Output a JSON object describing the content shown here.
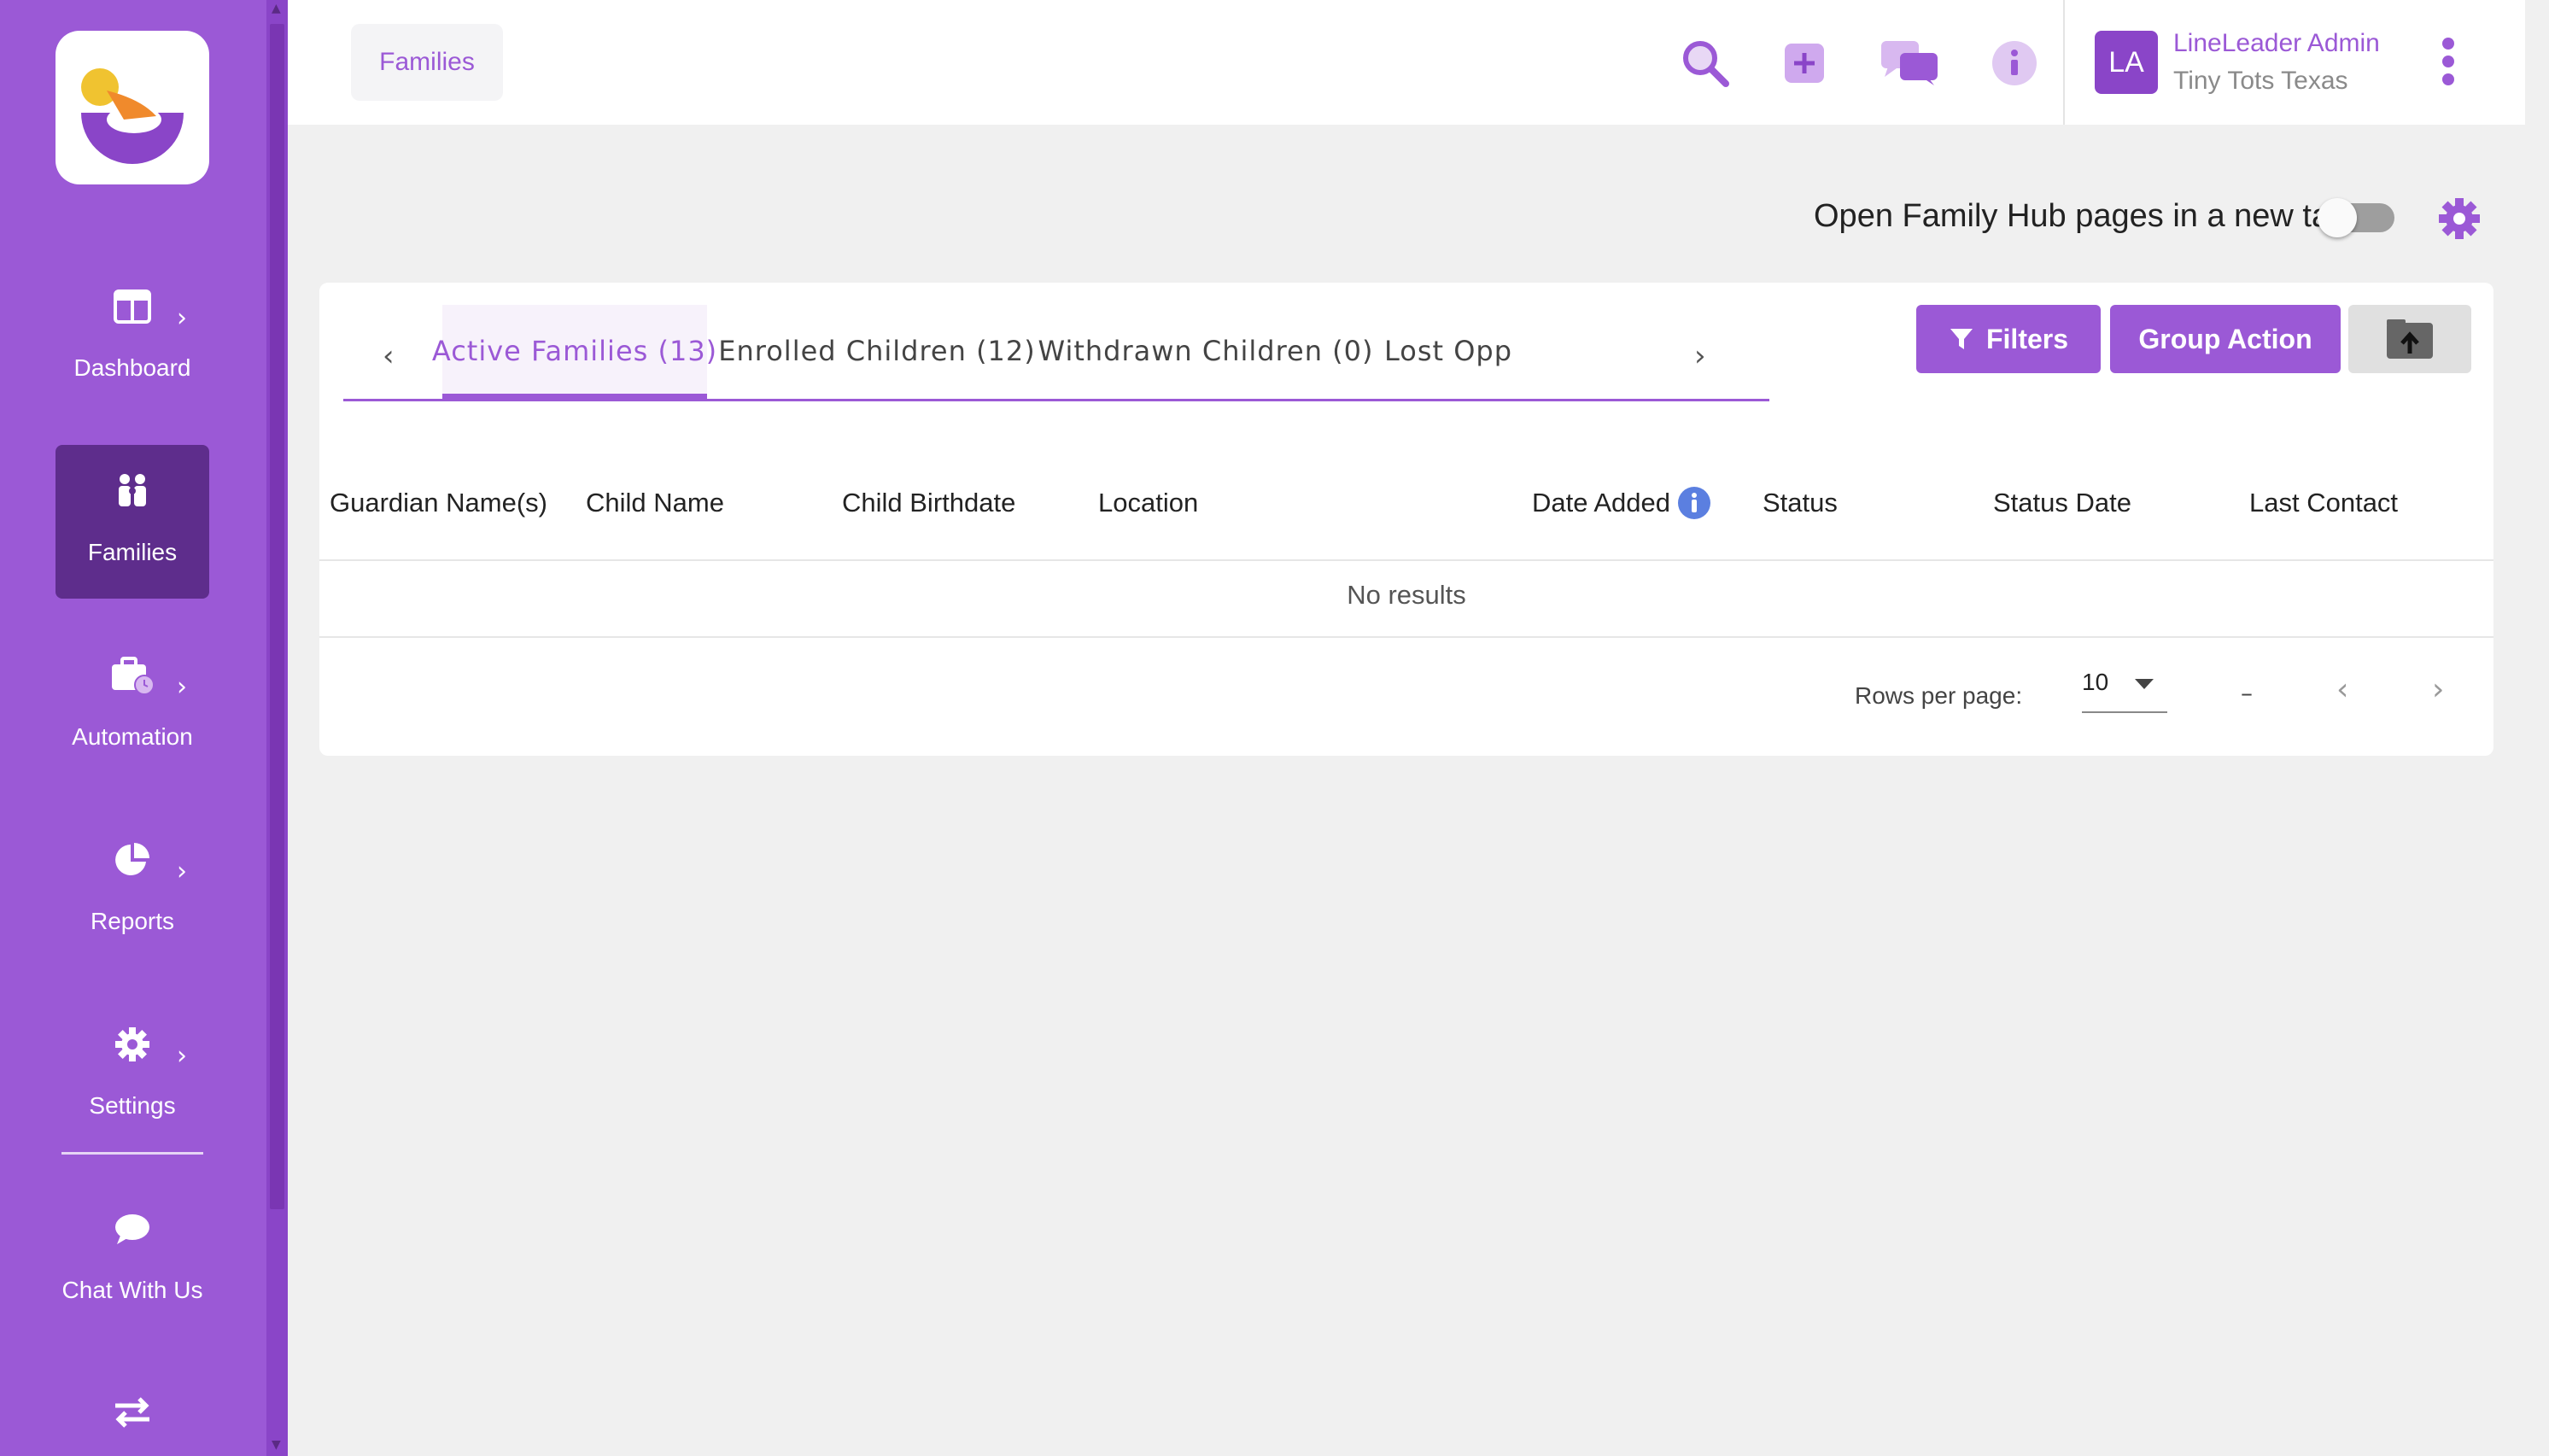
{
  "sidebar": {
    "items": [
      {
        "label": "Dashboard",
        "icon": "dashboard-icon",
        "has_chevron": true
      },
      {
        "label": "Families",
        "icon": "families-icon",
        "active": true
      },
      {
        "label": "Automation",
        "icon": "briefcase-clock-icon",
        "has_chevron": true
      },
      {
        "label": "Reports",
        "icon": "pie-chart-icon",
        "has_chevron": true
      },
      {
        "label": "Settings",
        "icon": "gear-icon",
        "has_chevron": true
      },
      {
        "label": "Chat With Us",
        "icon": "chat-bubble-icon"
      },
      {
        "label": "",
        "icon": "swap-arrows-icon"
      }
    ]
  },
  "header": {
    "breadcrumb": "Families",
    "user": {
      "initials": "LA",
      "name": "LineLeader Admin",
      "org": "Tiny Tots Texas"
    }
  },
  "options": {
    "toggle_label": "Open Family Hub pages in a new tab",
    "toggle_on": false
  },
  "tabs": [
    {
      "label": "Active Families (13)",
      "active": true
    },
    {
      "label": "Enrolled Children (12)"
    },
    {
      "label": "Withdrawn Children (0)"
    },
    {
      "label": "Lost Opp"
    }
  ],
  "actions": {
    "filters": "Filters",
    "group_action": "Group Action"
  },
  "table": {
    "columns": [
      "Guardian Name(s)",
      "Child Name",
      "Child Birthdate",
      "Location",
      "Date Added",
      "Status",
      "Status Date",
      "Last Contact"
    ],
    "empty_text": "No results"
  },
  "pagination": {
    "rows_label": "Rows per page:",
    "rows_value": "10",
    "range": "–"
  },
  "colors": {
    "brand": "#9b59d6",
    "sidebar_active": "#5e2d8c",
    "info_blue": "#5b7fe0"
  }
}
